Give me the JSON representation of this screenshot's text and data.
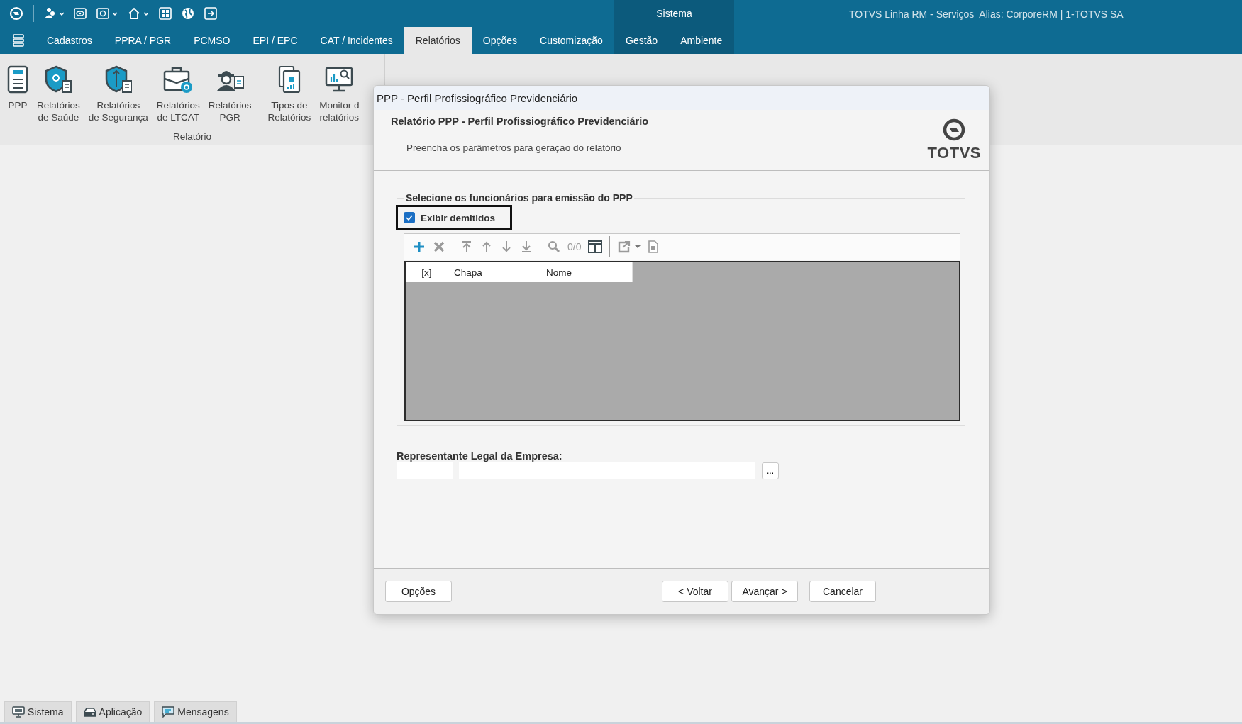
{
  "app": {
    "context_label": "Sistema",
    "title": "TOTVS Linha RM - Serviços  Alias: CorporeRM | 1-TOTVS SA"
  },
  "menu_tabs": [
    {
      "label": "Cadastros",
      "selected": false,
      "kind": "normal"
    },
    {
      "label": "PPRA / PGR",
      "selected": false,
      "kind": "normal"
    },
    {
      "label": "PCMSO",
      "selected": false,
      "kind": "normal"
    },
    {
      "label": "EPI / EPC",
      "selected": false,
      "kind": "normal"
    },
    {
      "label": "CAT / Incidentes",
      "selected": false,
      "kind": "normal"
    },
    {
      "label": "Relatórios",
      "selected": true,
      "kind": "normal"
    },
    {
      "label": "Opções",
      "selected": false,
      "kind": "normal"
    },
    {
      "label": "Customização",
      "selected": false,
      "kind": "normal"
    },
    {
      "label": "Gestão",
      "selected": false,
      "kind": "context"
    },
    {
      "label": "Ambiente",
      "selected": false,
      "kind": "context"
    }
  ],
  "ribbon": {
    "group_label": "Relatório",
    "sections": [
      [
        {
          "label": "PPP"
        },
        {
          "label": "Relatórios\nde Saúde"
        },
        {
          "label": "Relatórios\nde Segurança"
        },
        {
          "label": "Relatórios\nde LTCAT"
        },
        {
          "label": "Relatórios\nPGR"
        }
      ],
      [
        {
          "label": "Tipos de\nRelatórios"
        },
        {
          "label": "Monitor d\nrelatórios"
        }
      ]
    ]
  },
  "dialog": {
    "title": "PPP - Perfil Profissiográfico Previdenciário",
    "heading": "Relatório PPP - Perfil Profissiográfico Previdenciário",
    "subtitle": "Preencha os parâmetros para geração do relatório",
    "logo": "TOTVS",
    "group_legend": "Selecione os funcionários para emissão do PPP",
    "show_dismissed": {
      "label": "Exibir demitidos",
      "checked": true
    },
    "record_counter": "0/0",
    "grid_columns": [
      "[x]",
      "Chapa",
      "Nome"
    ],
    "representative_label": "Representante Legal da Empresa:",
    "browse_button": "...",
    "buttons": [
      {
        "label": "Opções",
        "kind": "left"
      },
      {
        "label": "< Voltar",
        "kind": "right"
      },
      {
        "label": "Avançar >",
        "kind": "right"
      },
      {
        "label": "Cancelar",
        "kind": "cancel"
      }
    ]
  },
  "status_tabs": [
    {
      "label": "Sistema"
    },
    {
      "label": "Aplicação"
    },
    {
      "label": "Mensagens"
    }
  ]
}
